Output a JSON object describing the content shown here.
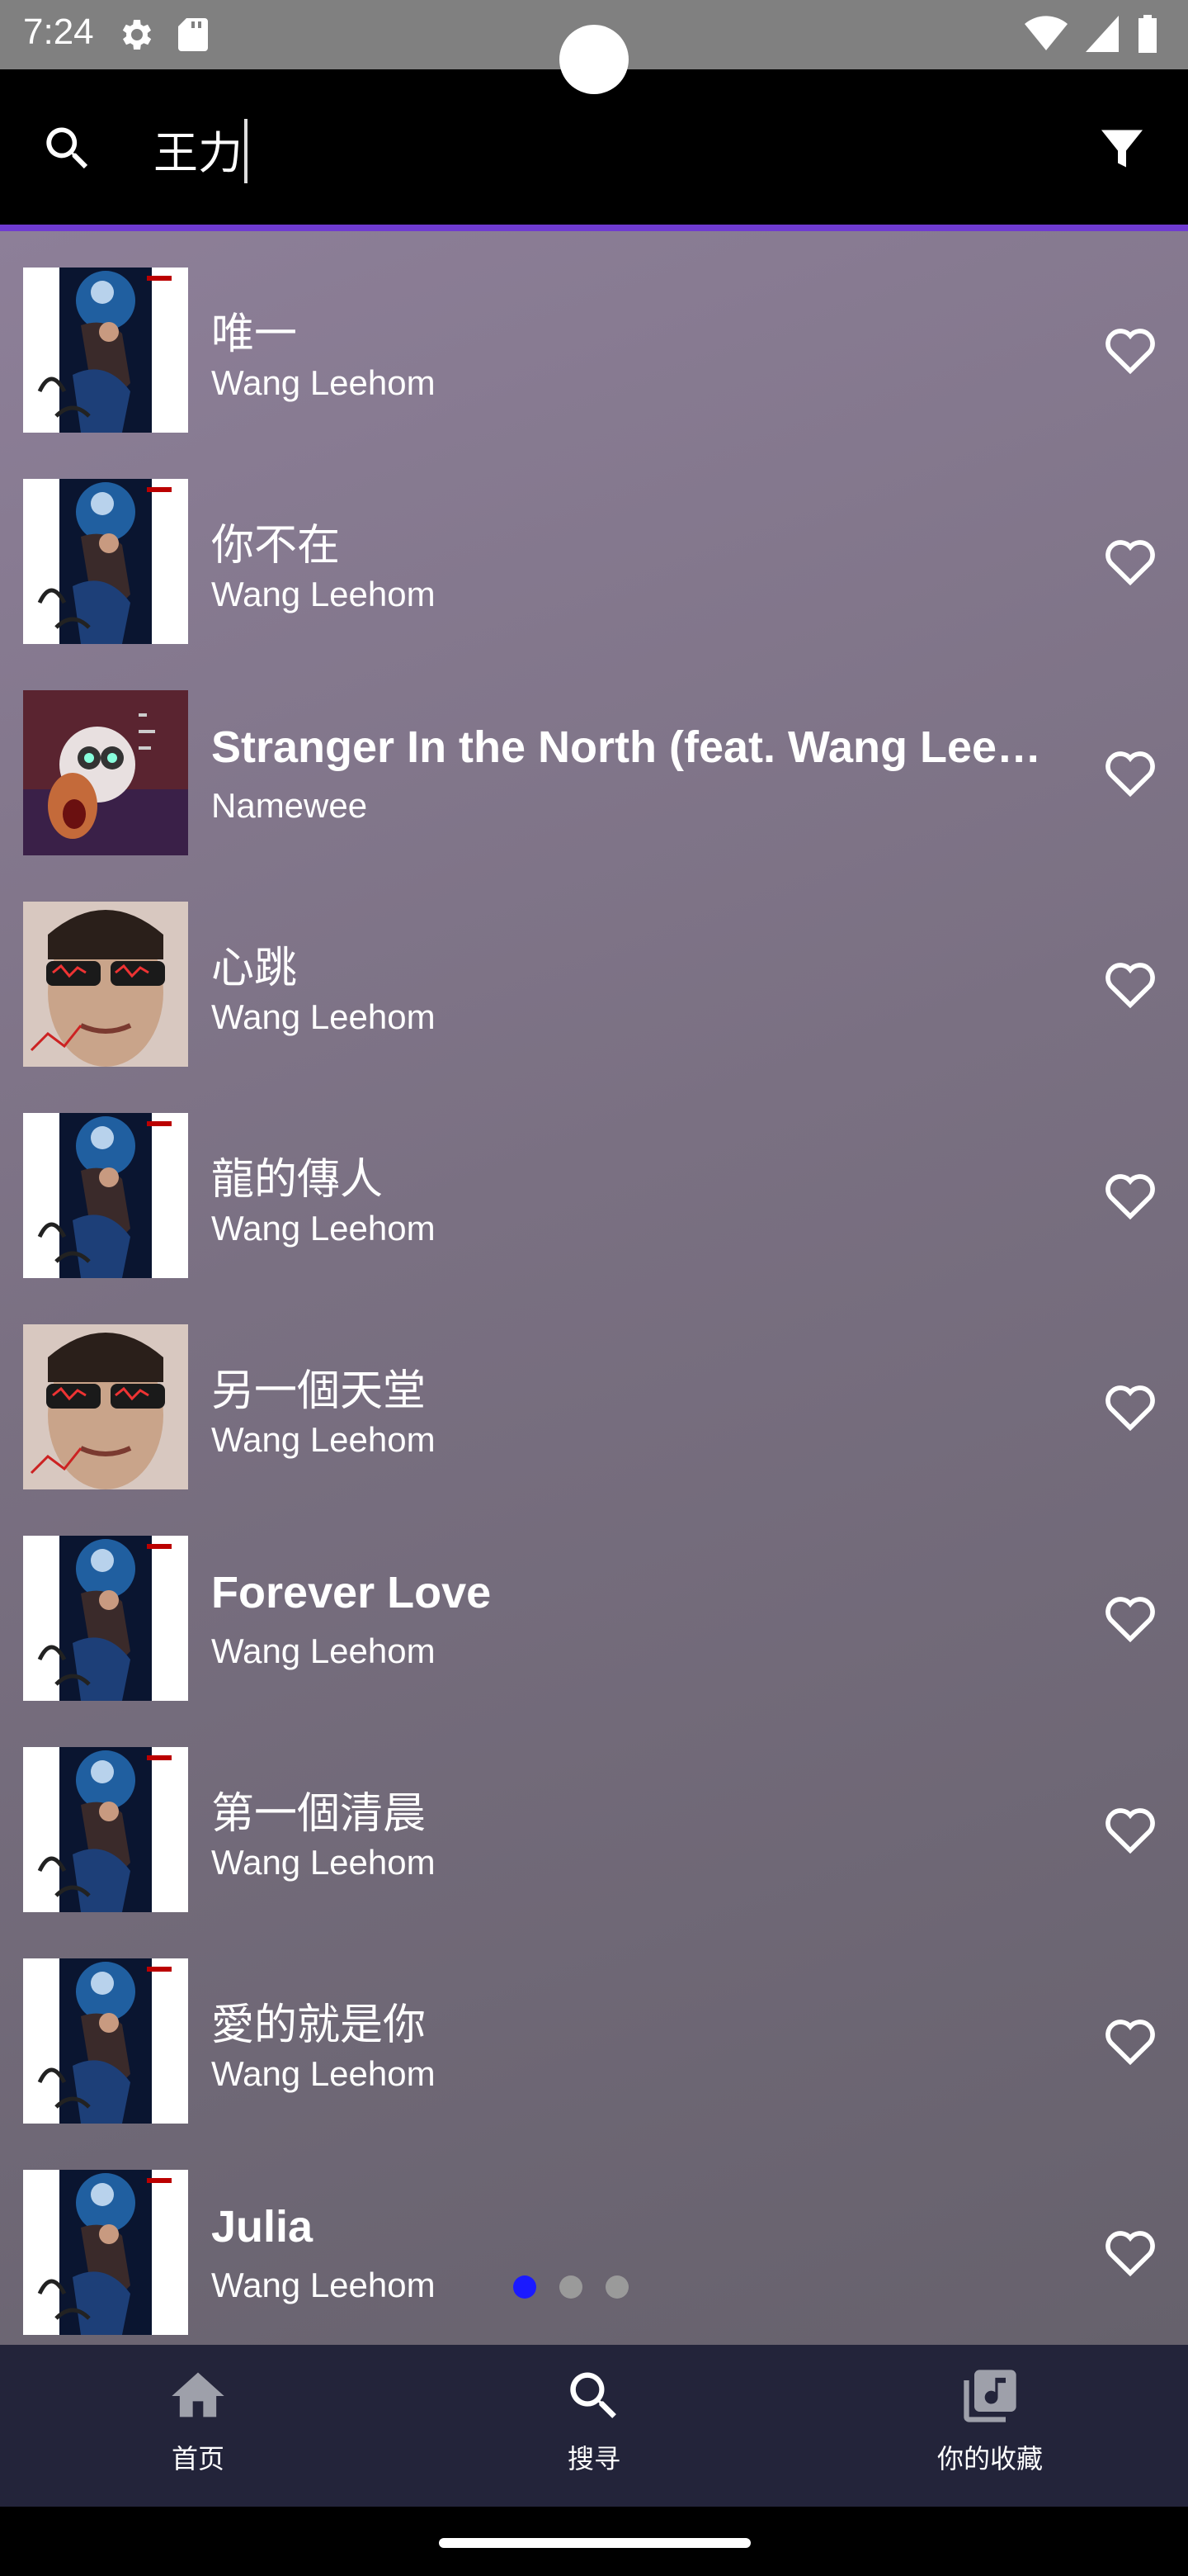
{
  "status_bar": {
    "time": "7:24"
  },
  "search": {
    "query": "王力"
  },
  "songs": [
    {
      "title": "唯一",
      "artist": "Wang Leehom",
      "cover": "hero"
    },
    {
      "title": "你不在",
      "artist": "Wang Leehom",
      "cover": "hero"
    },
    {
      "title": "Stranger In the North (feat. Wang Leehom)",
      "artist": "Namewee",
      "cover": "red"
    },
    {
      "title": "心跳",
      "artist": "Wang Leehom",
      "cover": "face"
    },
    {
      "title": "龍的傳人",
      "artist": "Wang Leehom",
      "cover": "hero"
    },
    {
      "title": "另一個天堂",
      "artist": "Wang Leehom",
      "cover": "face"
    },
    {
      "title": "Forever Love",
      "artist": "Wang Leehom",
      "cover": "hero"
    },
    {
      "title": "第一個清晨",
      "artist": "Wang Leehom",
      "cover": "hero"
    },
    {
      "title": "愛的就是你",
      "artist": "Wang Leehom",
      "cover": "hero"
    },
    {
      "title": "Julia",
      "artist": "Wang Leehom",
      "cover": "hero"
    }
  ],
  "pager": {
    "count": 3,
    "active": 0
  },
  "bottom_nav": [
    {
      "label": "首页",
      "icon": "home-icon"
    },
    {
      "label": "搜寻",
      "icon": "search-icon"
    },
    {
      "label": "你的收藏",
      "icon": "library-music-icon"
    }
  ],
  "colors": {
    "accent_line": "#6f3bd1",
    "pager_active": "#1a1aff",
    "nav_background": "#23243a"
  }
}
